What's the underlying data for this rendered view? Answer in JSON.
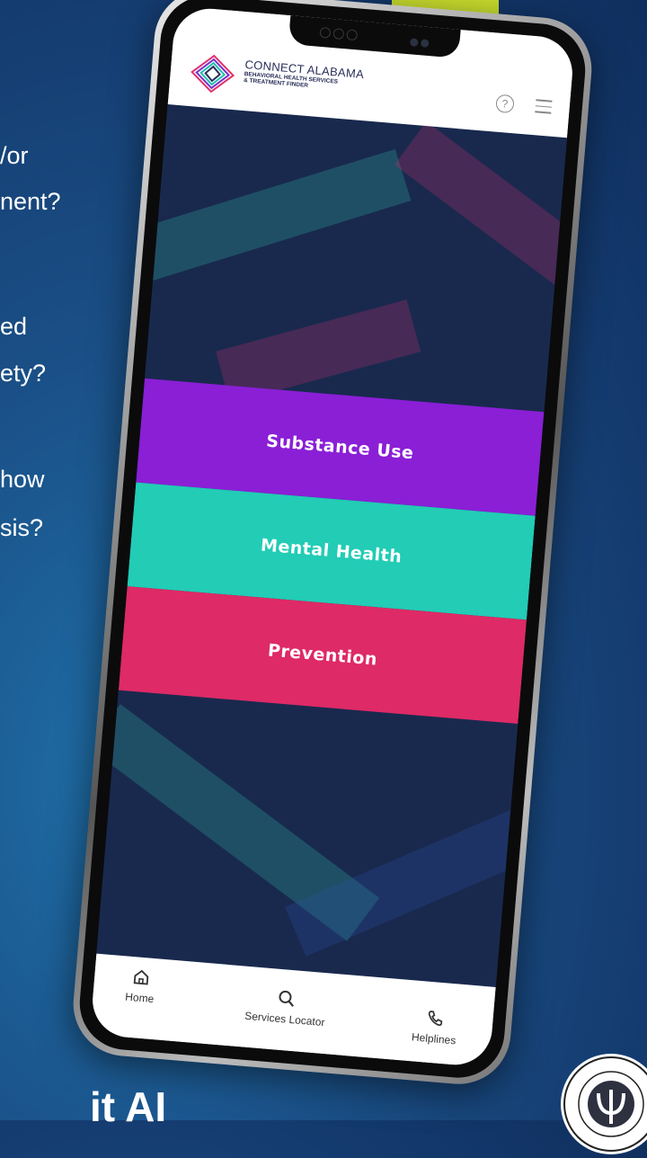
{
  "background_text": {
    "line1": "/or",
    "line2": "nent?",
    "line3": "ed",
    "line4": "ety?",
    "line5": "how",
    "line6": "sis?",
    "footer_fragment": "it AI"
  },
  "app": {
    "brand_title": "CONNECT ALABAMA",
    "brand_subtitle_1": "BEHAVIORAL HEALTH SERVICES",
    "brand_subtitle_2": "& TREATMENT FINDER"
  },
  "categories": [
    {
      "label": "Substance Use",
      "color": "#8a1fd6"
    },
    {
      "label": "Mental Health",
      "color": "#22ccb5"
    },
    {
      "label": "Prevention",
      "color": "#de2a66"
    }
  ],
  "bottom_nav": {
    "home": "Home",
    "services": "Services Locator",
    "helplines": "Helplines"
  },
  "colors": {
    "accent_green": "#c8dd2e",
    "screen_bg": "#19294e"
  }
}
